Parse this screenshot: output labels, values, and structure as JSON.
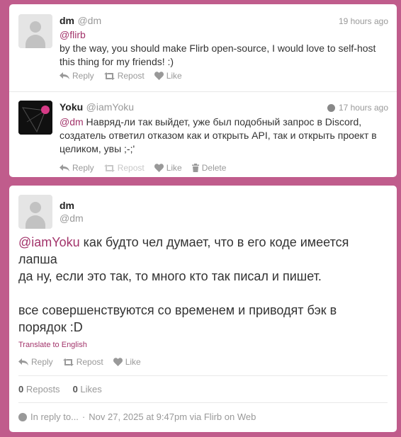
{
  "thread": {
    "tweet_a": {
      "name": "dm",
      "handle": "@dm",
      "time": "19 hours ago",
      "mention": "@flirb",
      "text_line1": "by the way, you should make Flirb open-source, I would love to self-host",
      "text_line2": "this thing for my friends! :)",
      "actions": {
        "reply": "Reply",
        "repost": "Repost",
        "like": "Like"
      }
    },
    "tweet_b": {
      "name": "Yoku",
      "handle": "@iamYoku",
      "time": "17 hours ago",
      "mention": "@dm",
      "text_line1": " Навряд-ли так выйдет, уже был подобный запрос в Discord,",
      "text_line2": "создатель ответил отказом как и открыть API, так и открыть проект в",
      "text_line3": "целиком, увы ;-;'",
      "actions": {
        "reply": "Reply",
        "repost": "Repost",
        "like": "Like",
        "delete": "Delete"
      }
    }
  },
  "main_tweet": {
    "name": "dm",
    "handle": "@dm",
    "mention": "@iamYoku",
    "line1": " как будто чел думает, что в его коде имеется",
    "line2": "лапша",
    "line3": "да ну, если это так, то много кто так писал и пишет.",
    "line4": "все совершенствуются со временем и приводят бэк в",
    "line5": "порядок :D",
    "translate": "Translate to English",
    "actions": {
      "reply": "Reply",
      "repost": "Repost",
      "like": "Like"
    },
    "reposts_count": "0",
    "reposts_label": "Reposts",
    "likes_count": "0",
    "likes_label": "Likes",
    "in_reply": "In reply to...",
    "dot": "·",
    "date": "Nov 27, 2025 at 9:47pm via Flirb on Web"
  },
  "colors": {
    "background": "#c05c8c",
    "accent": "#a2336a"
  }
}
